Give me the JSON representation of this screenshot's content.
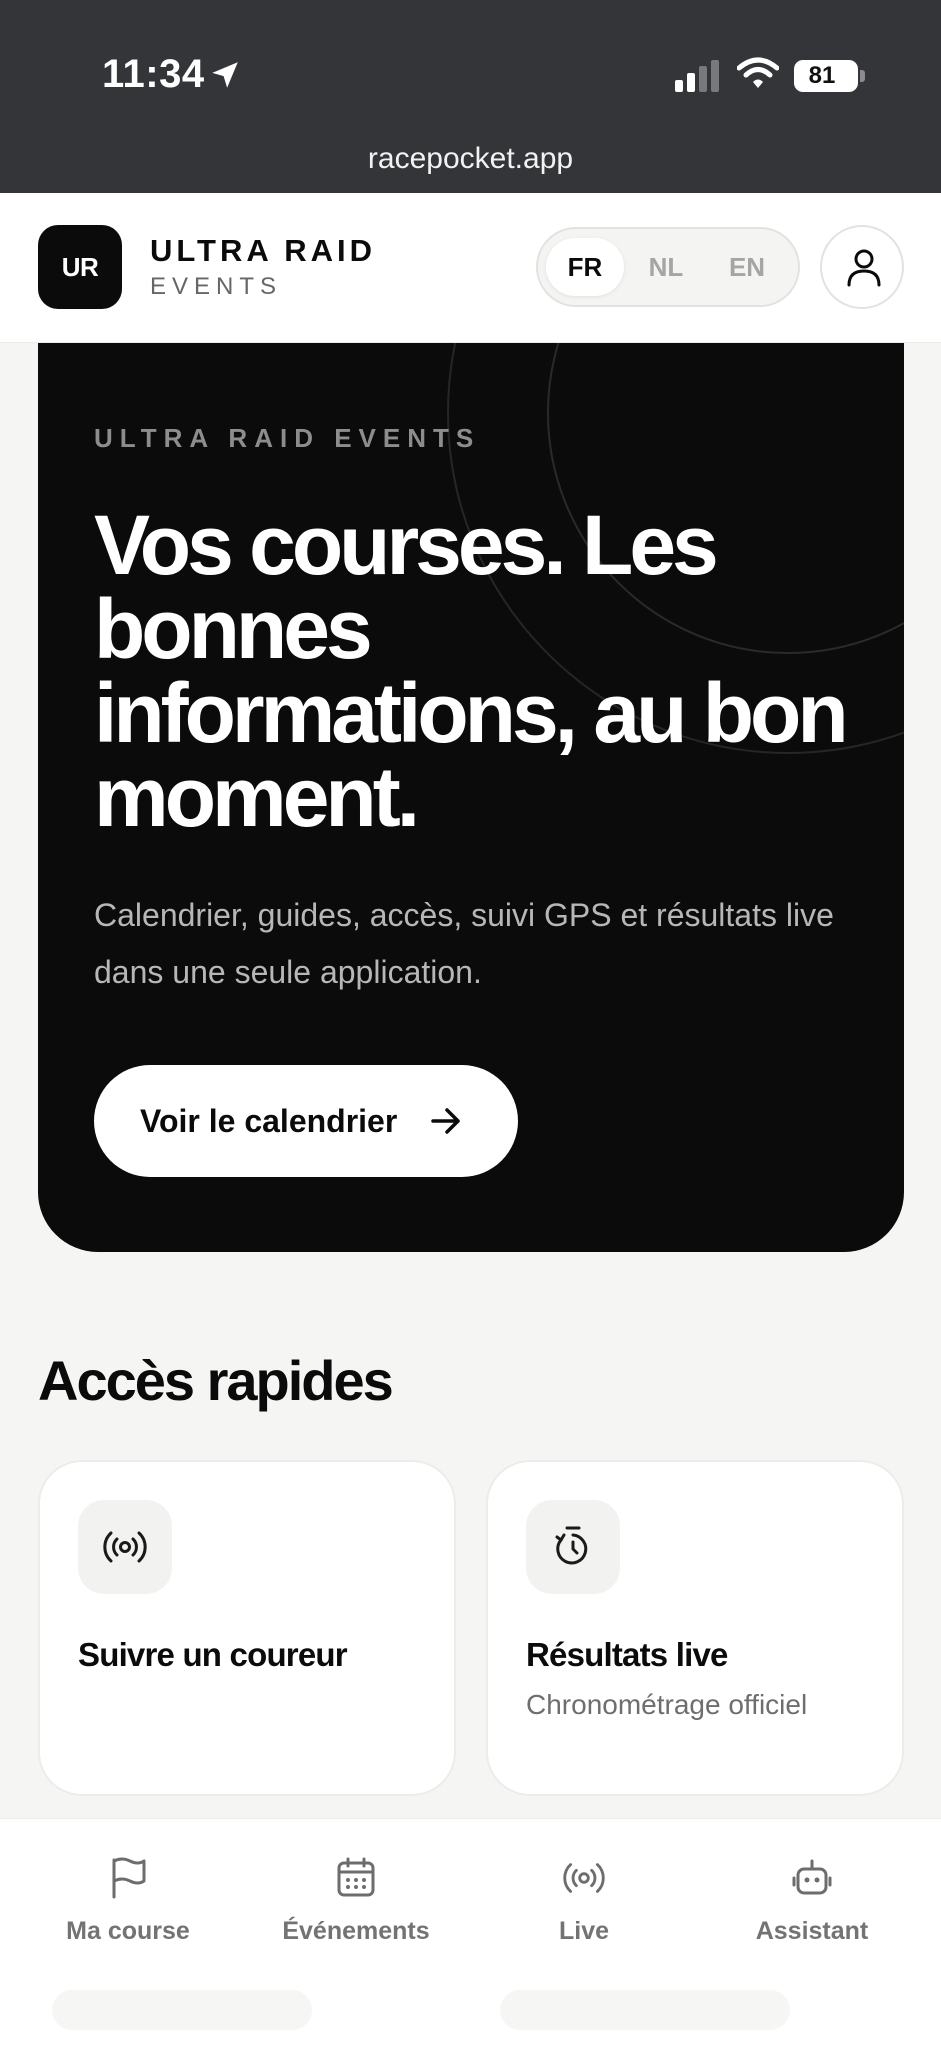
{
  "status_bar": {
    "time": "11:34",
    "battery": "81",
    "url": "racepocket.app"
  },
  "header": {
    "logo": "UR",
    "brand_name": "ULTRA RAID",
    "brand_sub": "EVENTS",
    "languages": [
      {
        "code": "FR",
        "active": true
      },
      {
        "code": "NL",
        "active": false
      },
      {
        "code": "EN",
        "active": false
      }
    ],
    "profile_icon": "user-icon"
  },
  "hero": {
    "eyebrow": "ULTRA RAID EVENTS",
    "title": "Vos courses. Les bonnes informations, au bon moment.",
    "description": "Calendrier, guides, accès, suivi GPS et résultats live dans une seule application.",
    "cta_label": "Voir le calendrier",
    "cta_icon": "arrow-right-icon"
  },
  "quick_access": {
    "title": "Accès rapides",
    "cards": [
      {
        "icon": "broadcast-icon",
        "title": "Suivre un coureur",
        "subtitle": ""
      },
      {
        "icon": "stopwatch-icon",
        "title": "Résultats live",
        "subtitle": "Chronométrage officiel"
      }
    ]
  },
  "bottom_nav": {
    "items": [
      {
        "label": "Ma course",
        "icon": "flag-icon"
      },
      {
        "label": "Événements",
        "icon": "calendar-icon"
      },
      {
        "label": "Live",
        "icon": "broadcast-icon"
      },
      {
        "label": "Assistant",
        "icon": "robot-icon"
      }
    ]
  },
  "colors": {
    "status_bar": "#333538",
    "hero_bg": "#0b0b0b",
    "page_bg": "#f5f5f4",
    "muted_text": "#737373"
  }
}
